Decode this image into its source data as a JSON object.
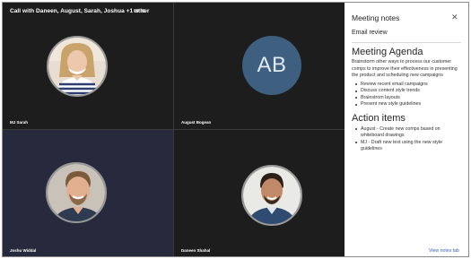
{
  "call": {
    "title": "Call with Daneen, August, Sarah, Joshua +1 other",
    "time": "00:01"
  },
  "participants": [
    {
      "name": "MJ Sarah",
      "avatar": "photo"
    },
    {
      "name": "August Bogean",
      "avatar": "initials",
      "initials": "AB"
    },
    {
      "name": "Joshu Widdal",
      "avatar": "photo"
    },
    {
      "name": "Daneen Shahal",
      "avatar": "photo"
    }
  ],
  "notes_panel": {
    "title": "Meeting notes",
    "close_icon": "close-icon",
    "subtitle": "Email review",
    "agenda_heading": "Meeting Agenda",
    "agenda_intro": "Brainstorm other ways to process our customer comps to improve their effectiveness in presenting the product and scheduling new campaigns",
    "agenda_items": [
      "Review recent email campaigns",
      "Discuss content style trends",
      "Brainstrom layouts",
      "Present new style guidelines"
    ],
    "actions_heading": "Action items",
    "action_items": [
      "August - Create new comps based on whiteboard drawings",
      "MJ - Draft new text using the new style guidelines"
    ],
    "footer_link": "View notes tab"
  },
  "colors": {
    "tile_dark": "#1d1d1d",
    "tile_navy": "#262a3c",
    "initials_avatar": "#3e5f80",
    "link": "#3b5fc0"
  }
}
